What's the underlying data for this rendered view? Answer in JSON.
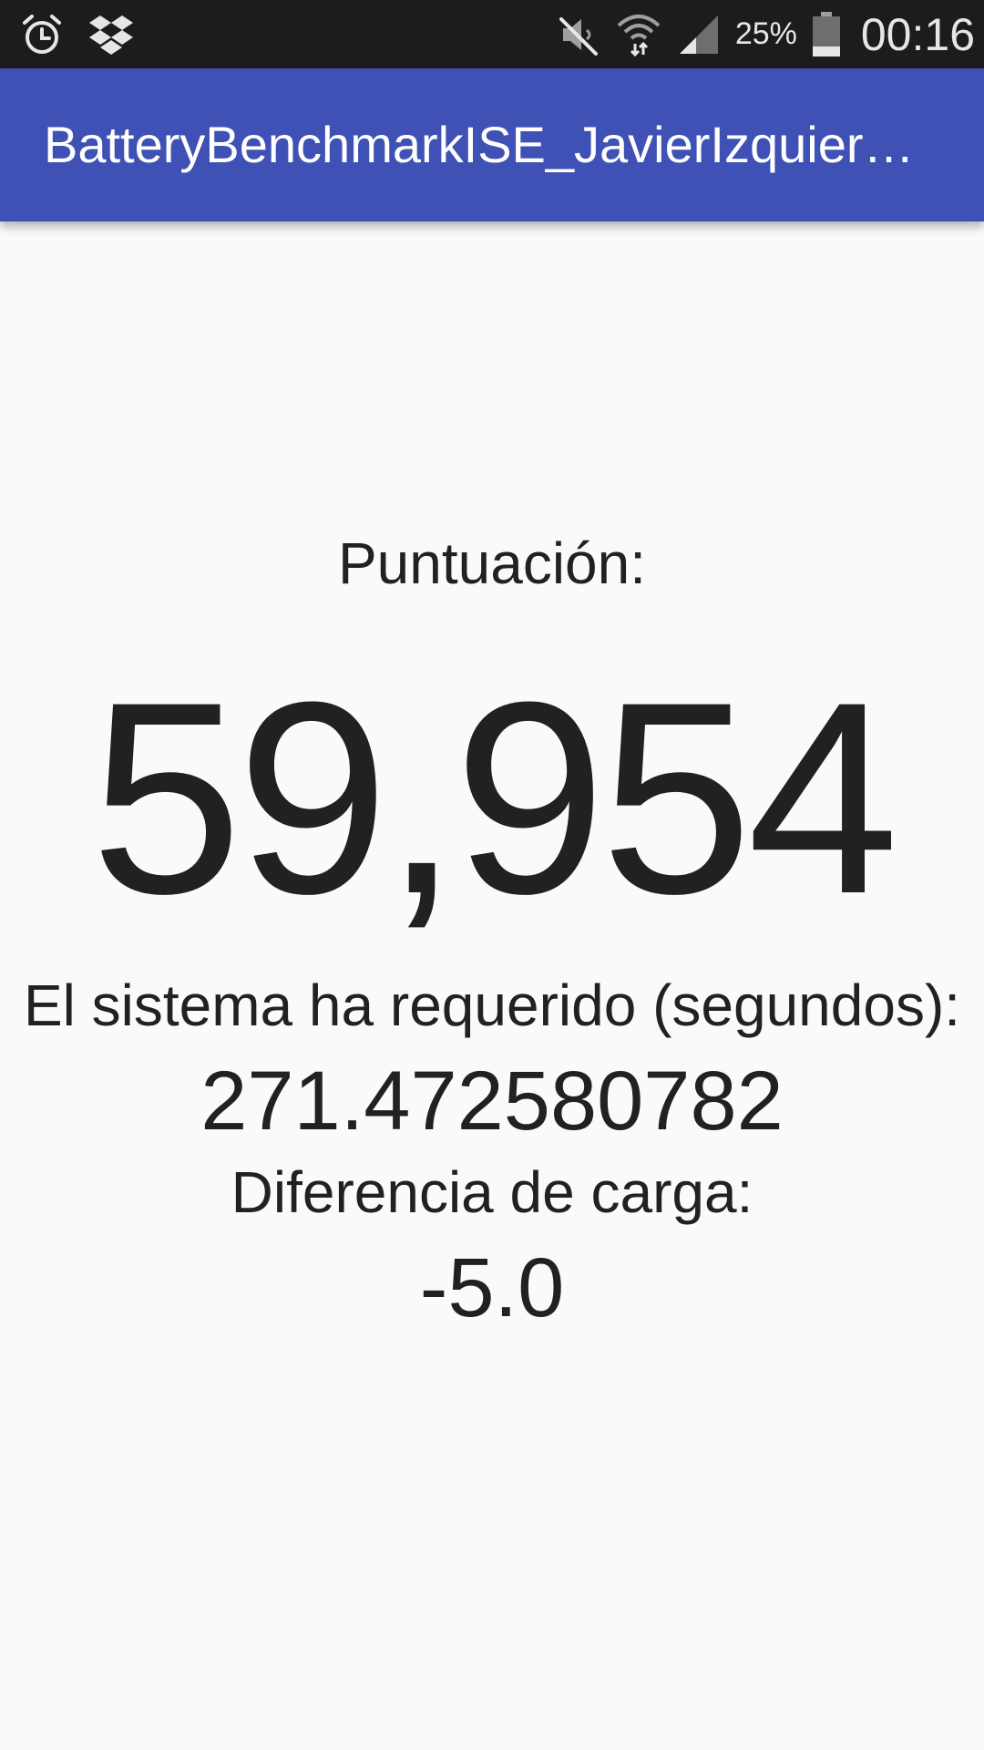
{
  "status_bar": {
    "left_icons": [
      "alarm-icon",
      "dropbox-icon"
    ],
    "right_icons": [
      "mute-icon",
      "wifi-icon",
      "signal-icon",
      "battery-icon"
    ],
    "battery_percent": "25%",
    "battery_level": 0.25,
    "time": "00:16"
  },
  "app_bar": {
    "title": "BatteryBenchmarkISE_JavierIzquierdo",
    "color": "#3f51b5"
  },
  "results": {
    "score_label": "Puntuación:",
    "score_value": "59,954",
    "time_label": "El sistema ha requerido (segundos):",
    "time_value": "271.472580782",
    "charge_label": "Diferencia de carga:",
    "charge_value": "-5.0"
  }
}
